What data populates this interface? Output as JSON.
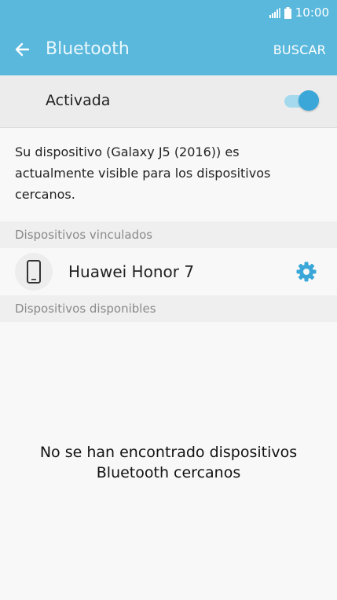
{
  "status_bar": {
    "time": "10:00",
    "icons": [
      "signal-icon",
      "battery-icon"
    ]
  },
  "app_bar": {
    "title": "Bluetooth",
    "action_label": "BUSCAR",
    "back_icon": "back-arrow-icon"
  },
  "master_switch": {
    "label": "Activada",
    "on": true
  },
  "info_text": "Su dispositivo (Galaxy J5 (2016)) es actualmente visible para los dispositivos cercanos.",
  "paired_section": {
    "header": "Dispositivos vinculados",
    "devices": [
      {
        "name": "Huawei Honor 7",
        "icon": "phone-icon",
        "settings_icon": "gear-icon"
      }
    ]
  },
  "available_section": {
    "header": "Dispositivos disponibles",
    "empty_line1": "No se han encontrado dispositivos",
    "empty_line2": "Bluetooth cercanos"
  },
  "colors": {
    "accent": "#5ab8dc",
    "toggle": "#3aa7d8",
    "gear": "#3aa7d8"
  }
}
